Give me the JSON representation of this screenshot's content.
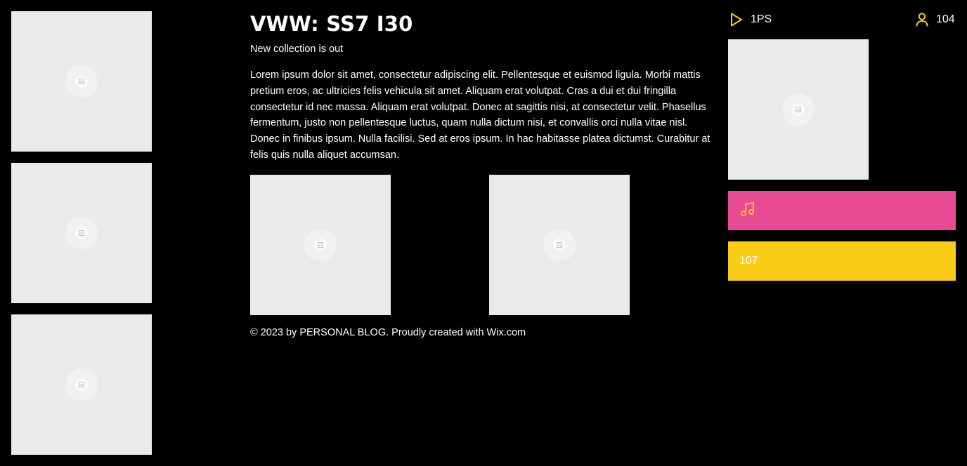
{
  "header": {
    "title": "VWW: SS7 I30",
    "subtitle": "New collection is out"
  },
  "article": {
    "body": "Lorem ipsum dolor sit amet, consectetur adipiscing elit. Pellentesque et euismod ligula. Morbi mattis pretium eros, ac ultricies felis vehicula sit amet. Aliquam erat volutpat. Cras a dui et dui fringilla consectetur id nec massa. Aliquam erat volutpat. Donec at sagittis nisi, at consectetur velit. Phasellus fermentum, justo non pellentesque luctus, quam nulla dictum nisi, et convallis orci nulla vitae nisl. Donec in finibus ipsum. Nulla facilisi. Sed at eros ipsum. In hac habitasse platea dictumst. Curabitur at felis quis nulla aliquet accumsan."
  },
  "footer": {
    "text": "© 2023 by PERSONAL BLOG. Proudly created with Wix.com"
  },
  "stats": {
    "plays_label": "1PS",
    "followers_count": "104",
    "yellow_bar_value": "107"
  },
  "icons": {
    "play": "play-icon",
    "user": "user-icon",
    "music": "music-note-icon",
    "image": "image-placeholder-icon"
  },
  "colors": {
    "background": "#000000",
    "accent_yellow": "#fbcc16",
    "accent_pink": "#e84a95",
    "placeholder": "#eaeaea",
    "text": "#ffffff"
  }
}
